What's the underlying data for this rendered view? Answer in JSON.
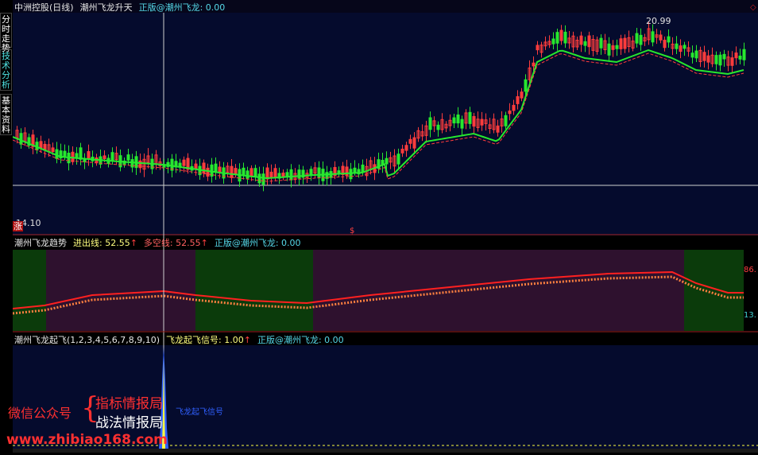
{
  "sidebar": {
    "tabs": [
      {
        "label": "分时走势",
        "active": false
      },
      {
        "label": "技术分析",
        "active": true
      },
      {
        "label": "基本资料",
        "active": false
      }
    ]
  },
  "main_panel": {
    "stock_name": "中洲控股(日线)",
    "indicator": "潮州飞龙升天",
    "legend": "正版@潮州飞龙: 0.00",
    "high_label": "20.99",
    "low_label": "14.10",
    "marker_text": "涨",
    "dollar_marker": "$"
  },
  "trend_panel": {
    "title": "潮州飞龙趋势",
    "line1": "进出线: 52.55",
    "line1_arrow": "↑",
    "line2": "多空线: 52.55",
    "line2_arrow": "↑",
    "legend": "正版@潮州飞龙: 0.00",
    "right_high": "86.",
    "right_low": "13."
  },
  "signal_panel": {
    "title": "潮州飞龙起飞(1,2,3,4,5,6,7,8,9,10)",
    "signal": "飞龙起飞信号: 1.00",
    "signal_arrow": "↑",
    "legend": "正版@潮州飞龙: 0.00",
    "small_label": "飞龙起飞信号"
  },
  "watermark": {
    "left": "微信公众号",
    "brace": "{",
    "line1": "指标情报局",
    "line2": "战法情报局",
    "url": "www.zhibiao168.com"
  },
  "colors": {
    "up": "#ff3c3c",
    "down": "#27e82e",
    "cyan": "#55d8e8",
    "yellow": "#ffff40",
    "blue": "#3060ff",
    "trend_green_bg": "#0b3b0b",
    "trend_purple_bg": "#2e112e",
    "main_bg": "#06061a"
  }
}
